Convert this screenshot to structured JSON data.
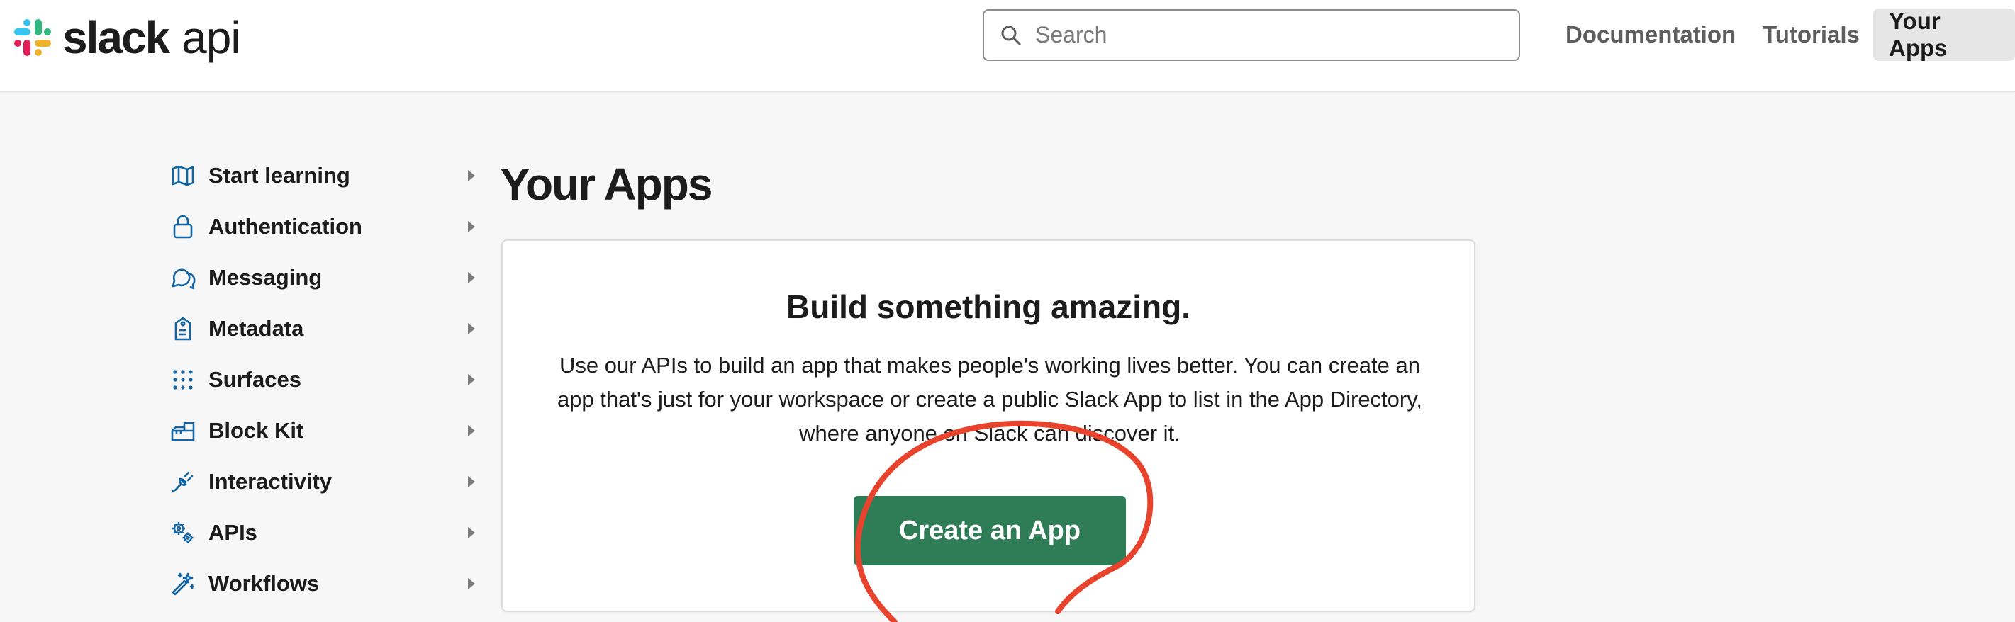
{
  "brand": {
    "name": "slack",
    "suffix": "api",
    "logo_icon": "slack-hash-logo",
    "logo_colors": [
      "#36c5f0",
      "#2eb67d",
      "#ecb22e",
      "#e01e5a"
    ]
  },
  "header": {
    "search": {
      "placeholder": "Search",
      "value": "",
      "icon": "search-icon"
    },
    "nav": [
      {
        "label": "Documentation",
        "active": false
      },
      {
        "label": "Tutorials",
        "active": false
      },
      {
        "label": "Your Apps",
        "active": true
      }
    ]
  },
  "sidebar": {
    "items": [
      {
        "label": "Start learning",
        "icon": "map-icon"
      },
      {
        "label": "Authentication",
        "icon": "lock-icon"
      },
      {
        "label": "Messaging",
        "icon": "message-icon"
      },
      {
        "label": "Metadata",
        "icon": "tag-icon"
      },
      {
        "label": "Surfaces",
        "icon": "grid-dots-icon"
      },
      {
        "label": "Block Kit",
        "icon": "blocks-icon"
      },
      {
        "label": "Interactivity",
        "icon": "plug-icon"
      },
      {
        "label": "APIs",
        "icon": "gears-icon"
      },
      {
        "label": "Workflows",
        "icon": "magic-wand-icon"
      }
    ],
    "icon_color": "#1264a3"
  },
  "main": {
    "title": "Your Apps",
    "card": {
      "heading": "Build something amazing.",
      "description": "Use our APIs to build an app that makes people's working lives better. You can create an app that's just for your workspace or create a public Slack App to list in the App Directory, where anyone on Slack can discover it.",
      "button_label": "Create an App",
      "button_color": "#2e7d57"
    }
  },
  "annotation": {
    "shape": "hand-drawn circle",
    "color": "#e8432d"
  }
}
